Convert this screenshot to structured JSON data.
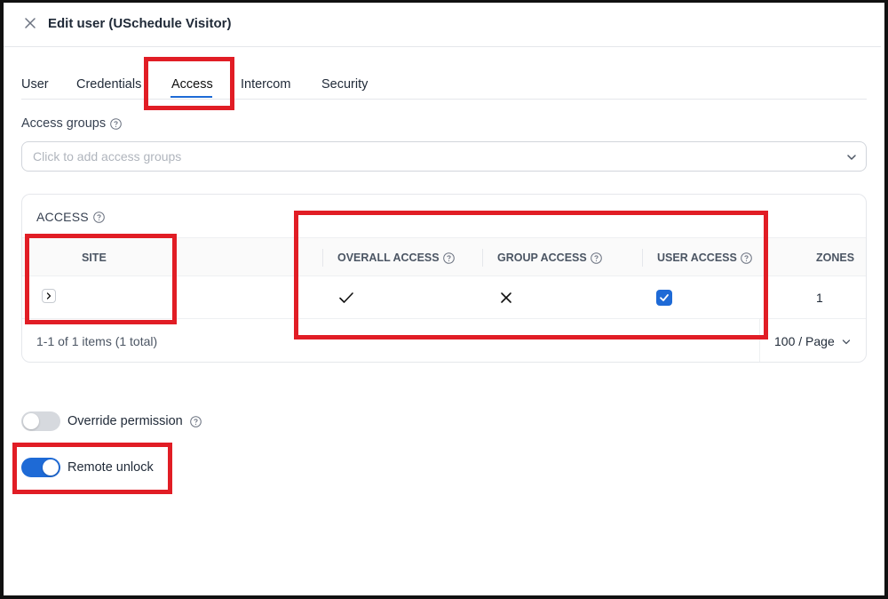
{
  "header": {
    "title": "Edit user (USchedule Visitor)"
  },
  "tabs": [
    {
      "label": "User",
      "active": false
    },
    {
      "label": "Credentials",
      "active": false
    },
    {
      "label": "Access",
      "active": true
    },
    {
      "label": "Intercom",
      "active": false
    },
    {
      "label": "Security",
      "active": false
    }
  ],
  "access_groups": {
    "label": "Access groups",
    "placeholder": "Click to add access groups"
  },
  "access_table": {
    "title": "ACCESS",
    "columns": [
      "SITE",
      "OVERALL ACCESS",
      "GROUP ACCESS",
      "USER ACCESS",
      "ZONES"
    ],
    "rows": [
      {
        "site": "",
        "overall_access": "check-icon",
        "group_access": "cross-icon",
        "user_access": true,
        "zones": "1"
      }
    ],
    "pagination_summary": "1-1 of 1 items (1 total)",
    "page_size": "100 / Page"
  },
  "toggles": {
    "override_permission": {
      "label": "Override permission",
      "on": false
    },
    "remote_unlock": {
      "label": "Remote unlock",
      "on": true
    }
  },
  "colors": {
    "accent": "#1e6ad6",
    "highlight": "#e11d25"
  }
}
